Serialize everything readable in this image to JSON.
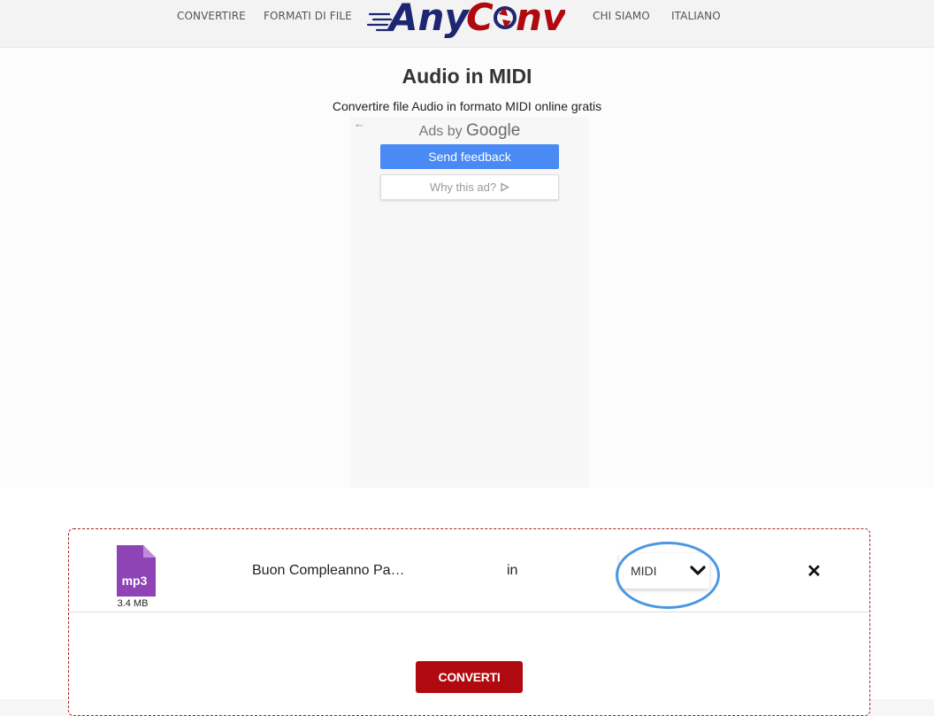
{
  "nav": {
    "converters": "CONVERTIRE",
    "file_formats": "FORMATI DI FILE",
    "about": "CHI SIAMO",
    "language": "ITALIANO"
  },
  "logo": {
    "part1": "Any",
    "part2": "C",
    "part3": "nv",
    "colors": {
      "blue": "#1d2670",
      "red": "#b0090f"
    }
  },
  "page": {
    "title": "Audio in MIDI",
    "subtitle": "Convertire file Audio in formato MIDI online gratis"
  },
  "ad": {
    "back_icon": "arrow-left-icon",
    "ads_by": "Ads by",
    "google": "Google",
    "send_feedback": "Send feedback",
    "why_this_ad": "Why this ad?",
    "why_icon": "adchoices-play-icon"
  },
  "file_row": {
    "file_type": "mp3",
    "file_size": "3.4 MB",
    "file_name": "Buon Compleanno Pa…",
    "in_label": "in",
    "target_format": "MIDI",
    "remove_icon": "close-icon",
    "file_icon_color": "#8e44b5"
  },
  "actions": {
    "convert": "CONVERTI"
  }
}
